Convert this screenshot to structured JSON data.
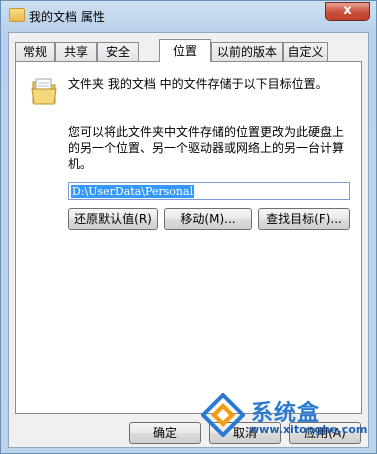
{
  "window": {
    "title": "我的文档 属性",
    "close_glyph": "x"
  },
  "tabs": [
    {
      "label": "常规"
    },
    {
      "label": "共享"
    },
    {
      "label": "安全"
    },
    {
      "label": "位置",
      "active": true
    },
    {
      "label": "以前的版本"
    },
    {
      "label": "自定义"
    }
  ],
  "location_tab": {
    "line1": "文件夹 我的文档 中的文件存储于以下目标位置。",
    "line2": "您可以将此文件夹中文件存储的位置更改为此硬盘上的另一个位置、另一个驱动器或网络上的另一台计算机。",
    "path_value": "D:\\UserData\\Personal",
    "restore_default_label": "还原默认值(R)",
    "move_label": "移动(M)...",
    "find_target_label": "查找目标(F)..."
  },
  "footer": {
    "ok_label": "确定",
    "cancel_label": "取消",
    "apply_label": "应用(A)"
  },
  "watermark": {
    "name": "系统盒",
    "url": "www.xitonghe.com"
  },
  "colors": {
    "selection": "#3399ff",
    "title_bar": "#b9d1ea",
    "close_button": "#c74f3b",
    "watermark": "#2b7ad0"
  }
}
